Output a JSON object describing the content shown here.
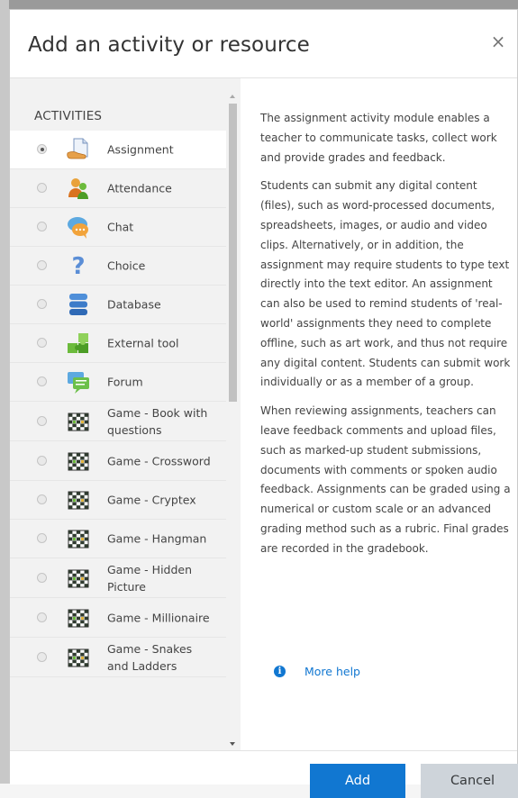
{
  "modal": {
    "title": "Add an activity or resource",
    "close_glyph": "×"
  },
  "activities": {
    "heading": "ACTIVITIES",
    "items": [
      {
        "label": "Assignment",
        "icon": "assignment-icon",
        "selected": true
      },
      {
        "label": "Attendance",
        "icon": "attendance-icon",
        "selected": false
      },
      {
        "label": "Chat",
        "icon": "chat-icon",
        "selected": false
      },
      {
        "label": "Choice",
        "icon": "choice-icon",
        "selected": false
      },
      {
        "label": "Database",
        "icon": "database-icon",
        "selected": false
      },
      {
        "label": "External tool",
        "icon": "external-tool-icon",
        "selected": false
      },
      {
        "label": "Forum",
        "icon": "forum-icon",
        "selected": false
      },
      {
        "label": "Game - Book with questions",
        "icon": "game-icon",
        "selected": false
      },
      {
        "label": "Game - Crossword",
        "icon": "game-icon",
        "selected": false
      },
      {
        "label": "Game - Cryptex",
        "icon": "game-icon",
        "selected": false
      },
      {
        "label": "Game - Hangman",
        "icon": "game-icon",
        "selected": false
      },
      {
        "label": "Game - Hidden Picture",
        "icon": "game-icon",
        "selected": false
      },
      {
        "label": "Game - Millionaire",
        "icon": "game-icon",
        "selected": false
      },
      {
        "label": "Game - Snakes and Ladders",
        "icon": "game-icon",
        "selected": false
      }
    ]
  },
  "description": {
    "paragraphs": [
      "The assignment activity module enables a teacher to communicate tasks, collect work and provide grades and feedback.",
      "Students can submit any digital content (files), such as word-processed documents, spreadsheets, images, or audio and video clips. Alternatively, or in addition, the assignment may require students to type text directly into the text editor. An assignment can also be used to remind students of 'real-world' assignments they need to complete offline, such as art work, and thus not require any digital content. Students can submit work individually or as a member of a group.",
      "When reviewing assignments, teachers can leave feedback comments and upload files, such as marked-up student submissions, documents with comments or spoken audio feedback. Assignments can be graded using a numerical or custom scale or an advanced grading method such as a rubric. Final grades are recorded in the gradebook."
    ],
    "more_help": "More help"
  },
  "footer": {
    "add_label": "Add",
    "cancel_label": "Cancel"
  },
  "colors": {
    "primary": "#1177d1",
    "secondary_button": "#ced4da",
    "list_background": "#f2f2f2"
  }
}
